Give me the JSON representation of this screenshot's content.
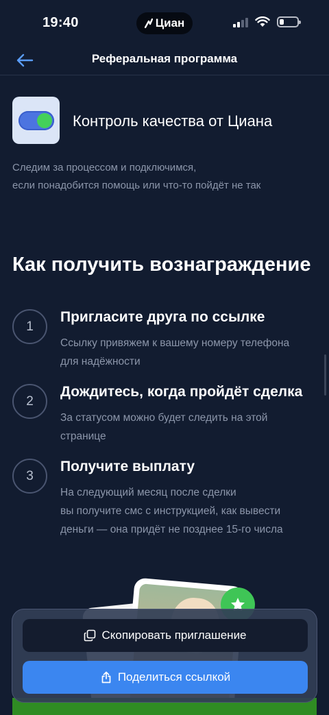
{
  "status_bar": {
    "time": "19:40",
    "dynamic_island_label": "Циан"
  },
  "nav": {
    "title": "Реферальная программа",
    "back_icon": "arrow-left-icon"
  },
  "quality": {
    "title": "Контроль качества от Циана",
    "desc_lines": [
      "Следим за процессом и подключимся,",
      "если понадобится помощь или что-то пойдёт не так"
    ],
    "icon": "toggle-switch-icon"
  },
  "how_to": {
    "title": "Как получить вознаграждение",
    "steps": [
      {
        "number": "1",
        "title": "Пригласите друга по ссылке",
        "desc_lines": [
          "Ссылку привяжем к вашему номеру телефона",
          "для надёжности"
        ]
      },
      {
        "number": "2",
        "title": "Дождитесь, когда пройдёт сделка",
        "desc_lines": [
          "За статусом можно будет следить на этой",
          "странице"
        ]
      },
      {
        "number": "3",
        "title": "Получите выплату",
        "desc_lines": [
          "На следующий месяц после сделки",
          "вы получите смс с инструкцией, как вывести",
          "деньги — она придёт не позднее 15-го числа"
        ]
      }
    ]
  },
  "actions": {
    "copy_label": "Скопировать приглашение",
    "share_label": "Поделиться ссылкой"
  },
  "colors": {
    "background": "#121c30",
    "accent_blue": "#3b86f0",
    "accent_green": "#44d05a",
    "muted_text": "#8c96aa"
  }
}
